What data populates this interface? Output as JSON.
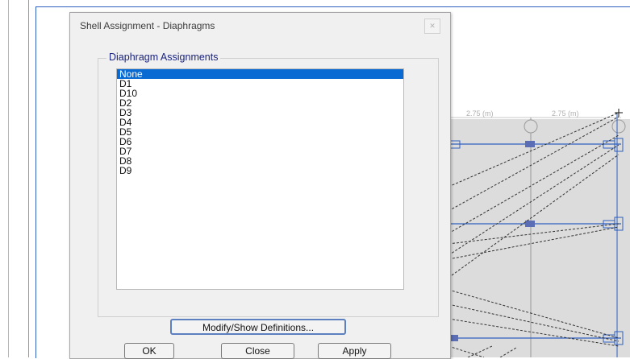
{
  "dialog": {
    "title": "Shell Assignment - Diaphragms",
    "close_icon": "close-icon",
    "group_label": "Diaphragm Assignments",
    "list_items": [
      "None",
      "D1",
      "D10",
      "D2",
      "D3",
      "D4",
      "D5",
      "D6",
      "D7",
      "D8",
      "D9"
    ],
    "selected_item": "None",
    "modify_label": "Modify/Show Definitions...",
    "ok_label": "OK",
    "close_label": "Close",
    "apply_label": "Apply"
  },
  "model_view": {
    "dim_label_1": "2.75 (m)",
    "dim_label_2": "2.75 (m)",
    "colors": {
      "grid_blue": "#2f5fbf",
      "node_fill": "#5a6db5",
      "shell_fill": "#dcdcdc"
    }
  }
}
